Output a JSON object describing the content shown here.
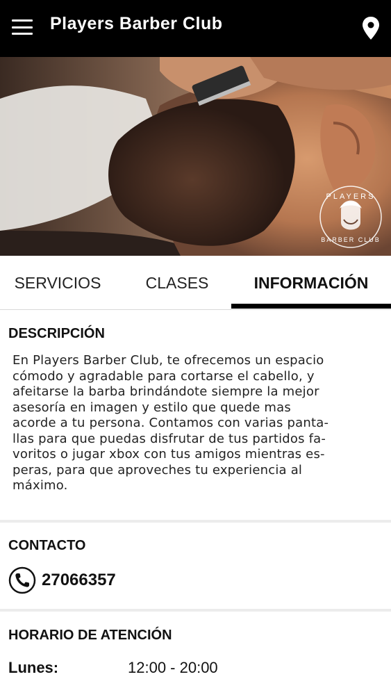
{
  "appbar": {
    "title": "Players Barber Club",
    "menu_icon": "hamburger-menu-icon",
    "location_icon": "location-pin-icon"
  },
  "hero": {
    "logo_text_top": "PLAYERS",
    "logo_text_bottom": "BARBER CLUB"
  },
  "tabs": [
    {
      "label": "SERVICIOS",
      "active": false
    },
    {
      "label": "CLASES",
      "active": false
    },
    {
      "label": "INFORMACIÓN",
      "active": true
    }
  ],
  "description": {
    "title": "DESCRIPCIÓN",
    "lines": [
      "En Players Barber Club, te ofrecemos un espacio",
      "cómodo y agradable para cortarse el cabello, y",
      "afeitarse la barba brindándote siempre la mejor",
      "asesoría en imagen y estilo que quede mas",
      "acorde a tu persona. Contamos con varias panta-",
      "llas para que puedas disfrutar de tus partidos fa-",
      "voritos o jugar xbox con tus amigos mientras es-",
      "peras, para que aproveches tu experiencia al",
      "máximo."
    ]
  },
  "contact": {
    "title": "CONTACTO",
    "phone": "27066357",
    "phone_icon": "phone-icon"
  },
  "hours": {
    "title": "HORARIO DE ATENCIÓN",
    "rows": [
      {
        "day": "Lunes:",
        "time": "12:00 - 20:00"
      }
    ]
  },
  "colors": {
    "appbar_bg": "#000000",
    "accent": "#000000",
    "divider": "#ececec"
  }
}
